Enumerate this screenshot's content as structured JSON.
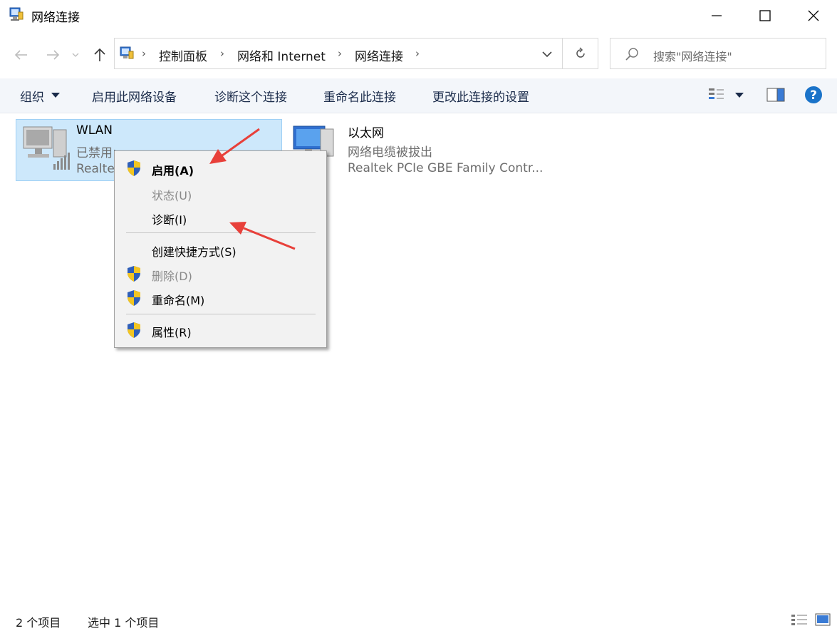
{
  "window": {
    "title": "网络连接"
  },
  "nav": {
    "back_icon": "arrow-left-icon",
    "forward_icon": "arrow-right-icon",
    "recent_icon": "chevron-down-icon",
    "up_icon": "arrow-up-icon"
  },
  "address": {
    "crumbs": [
      "控制面板",
      "网络和 Internet",
      "网络连接"
    ],
    "search_placeholder": "搜索\"网络连接\""
  },
  "toolbar": {
    "organize": "组织",
    "enable_device": "启用此网络设备",
    "diagnose": "诊断这个连接",
    "rename": "重命名此连接",
    "change_settings": "更改此连接的设置"
  },
  "items": [
    {
      "name": "WLAN",
      "status": "已禁用",
      "adapter": "Realte"
    },
    {
      "name": "以太网",
      "status": "网络电缆被拔出",
      "adapter": "Realtek PCIe GBE Family Contr..."
    }
  ],
  "context_menu": {
    "enable": "启用(A)",
    "status": "状态(U)",
    "diagnose": "诊断(I)",
    "create_shortcut": "创建快捷方式(S)",
    "delete": "删除(D)",
    "rename": "重命名(M)",
    "properties": "属性(R)"
  },
  "statusbar": {
    "count": "2 个项目",
    "selected": "选中 1 个项目"
  },
  "colors": {
    "selection": "#cde8fb",
    "annotation_arrow": "#e8403a",
    "help": "#1a73c9"
  }
}
